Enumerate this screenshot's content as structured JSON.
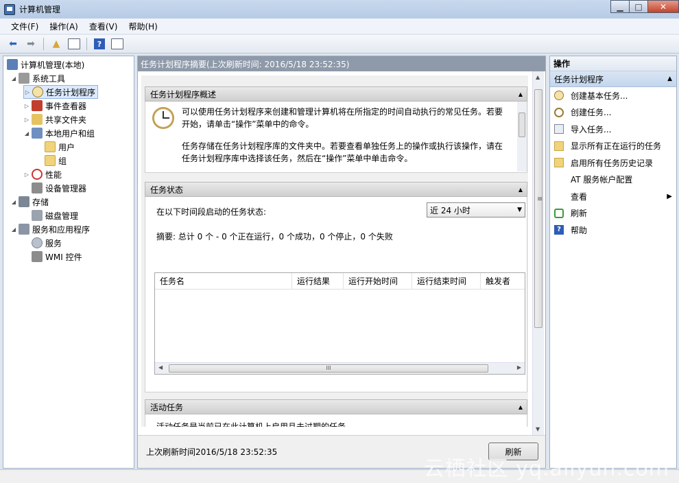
{
  "window": {
    "title": "计算机管理"
  },
  "menu": [
    "文件(F)",
    "操作(A)",
    "查看(V)",
    "帮助(H)"
  ],
  "tree": {
    "root": "计算机管理(本地)",
    "items": [
      {
        "label": "系统工具"
      },
      {
        "label": "任务计划程序"
      },
      {
        "label": "事件查看器"
      },
      {
        "label": "共享文件夹"
      },
      {
        "label": "本地用户和组"
      },
      {
        "label": "用户"
      },
      {
        "label": "组"
      },
      {
        "label": "性能"
      },
      {
        "label": "设备管理器"
      },
      {
        "label": "存储"
      },
      {
        "label": "磁盘管理"
      },
      {
        "label": "服务和应用程序"
      },
      {
        "label": "服务"
      },
      {
        "label": "WMI 控件"
      }
    ]
  },
  "middle": {
    "header": "任务计划程序摘要(上次刷新时间: 2016/5/18 23:52:35)",
    "overview": {
      "title": "任务计划程序概述",
      "para1_line1": "可以使用任务计划程序来创建和管理计算机将在所指定的时间自动执行的常见任务。若要",
      "para1_line2": "开始，请单击“操作”菜单中的命令。",
      "para2_line1": "任务存储在任务计划程序库的文件夹中。若要查看单独任务上的操作或执行该操作，请在",
      "para2_line2": "任务计划程序库中选择该任务，然后在“操作”菜单中单击命令。"
    },
    "status": {
      "title": "任务状态",
      "period_label": "在以下时间段启动的任务状态:",
      "period_value": "近 24 小时",
      "summary": "摘要: 总计 0 个 - 0 个正在运行，0 个成功，0 个停止，0 个失败",
      "columns": [
        "任务名",
        "运行结果",
        "运行开始时间",
        "运行结束时间",
        "触发者"
      ],
      "scroll_grip": "III"
    },
    "active": {
      "title": "活动任务",
      "partial_text": "活动任务是当前已在此计算机上启用且未过期的任务。"
    },
    "footer": {
      "last_refresh": "上次刷新时间2016/5/18 23:52:35",
      "refresh_button": "刷新"
    }
  },
  "actions": {
    "header": "操作",
    "section": "任务计划程序",
    "items": [
      {
        "label": "创建基本任务...",
        "icon": "clock-icon"
      },
      {
        "label": "创建任务...",
        "icon": "task-icon"
      },
      {
        "label": "导入任务...",
        "icon": "import-icon"
      },
      {
        "label": "显示所有正在运行的任务",
        "icon": "folder-icon"
      },
      {
        "label": "启用所有任务历史记录",
        "icon": "folder-icon"
      },
      {
        "label": "AT 服务帐户配置",
        "icon": ""
      },
      {
        "label": "查看",
        "icon": ""
      },
      {
        "label": "刷新",
        "icon": "refresh-icon"
      },
      {
        "label": "帮助",
        "icon": "help-icon"
      }
    ]
  },
  "watermark": "云栖社区 yq.aliyun.com"
}
